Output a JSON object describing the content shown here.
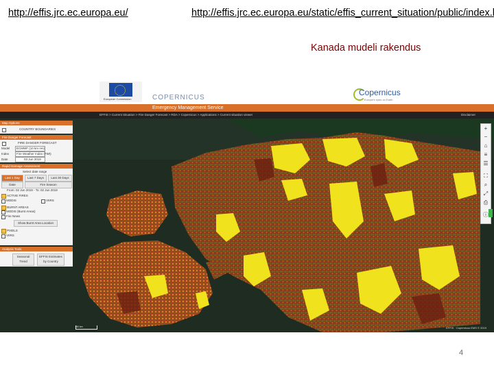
{
  "slide": {
    "link_left": "http://effis.jrc.ec.europa.eu/",
    "link_right": "http://effis.jrc.ec.europa.eu/static/effis_current_situation/public/index.html",
    "subtitle": "Kanada mudeli rakendus",
    "page_number": "4"
  },
  "screenshot": {
    "header": {
      "copernicus_left": "COPERNICUS",
      "ems_title": "Emergency Management Service",
      "copernicus_right": "Copernicus",
      "copernicus_tagline": "Europe's eyes on Earth",
      "eu_caption": "European Commission"
    },
    "nav": {
      "items": "EFFIS > Current Situation > Fire Danger Forecast > RDA > Copernicus > Applications > Current situation viewer",
      "right": "Disclaimer"
    },
    "panel": {
      "map_options_head": "Map Options",
      "country_boundaries": "COUNTRY BOUNDARIES",
      "fire_danger_head": "Fire Danger Forecast",
      "fire_danger_forecast": "FIRE DANGER FORECAST",
      "row_model_label": "Model",
      "row_model_value": "ECMWF (10 km res)",
      "row_index_label": "Index",
      "row_index_value": "Fire Weather Index (FWI)",
      "row_date_label": "Date",
      "row_date_value": "03 Jun 2019",
      "rda_head": "Rapid Damage Assessment",
      "select_range": "Select date range",
      "btn_last1": "Last 1 Day",
      "btn_last7": "Last 7 Days",
      "btn_last30": "Last 30 Days",
      "btn_date": "Date",
      "btn_season": "Fire Season",
      "date_range": "From: 02 Jun 2019 - To: 02 Jun 2019",
      "active_fires": "ACTIVE FIRES",
      "modis": "MODIS",
      "viirs": "VIIRS",
      "burnt_areas": "BURNT AREAS",
      "burnt_areas_sub": "MODIS (Burnt Areas)",
      "fire_news": "Fire News",
      "show_btn": "Show Burnt Area Location",
      "pixels": "PIXELS",
      "viirs_short": "VIIRS",
      "analysis_head": "Analysis Tools",
      "seasonal_btn": "Seasonal Trend",
      "estimates_btn": "EFFIS Estimates by Country"
    },
    "map": {
      "attribution": "EFFIS · Copernicus EMS © 2019",
      "scale": "50 km"
    }
  }
}
